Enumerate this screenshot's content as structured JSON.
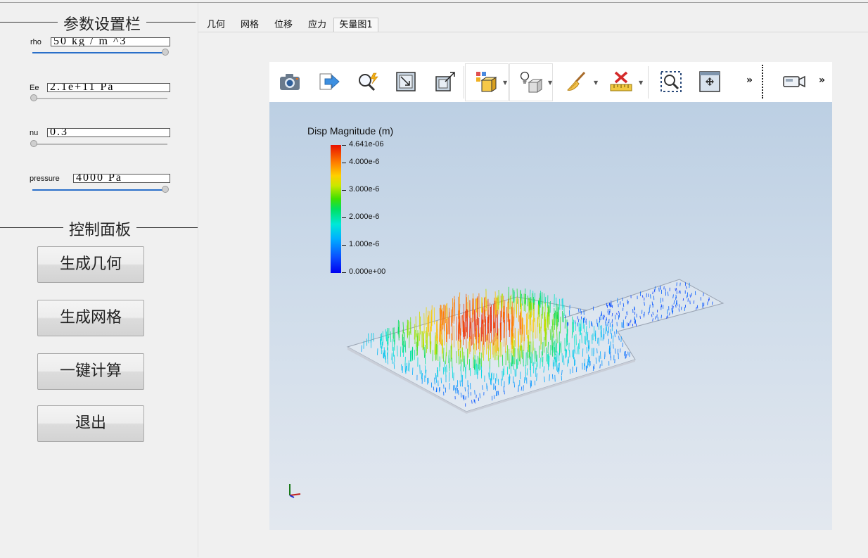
{
  "params": {
    "title": "参数设置栏",
    "items": [
      {
        "label": "rho",
        "value": "50 kg / m ^3",
        "slider": 1.0
      },
      {
        "label": "Ee",
        "value": "2.1e+11 Pa",
        "slider": 0.0
      },
      {
        "label": "nu",
        "value": "0.3",
        "slider": 0.0
      },
      {
        "label": "pressure",
        "value": "4000 Pa",
        "slider": 1.0
      }
    ]
  },
  "control": {
    "title": "控制面板",
    "buttons": [
      "生成几何",
      "生成网格",
      "一键计算",
      "退出"
    ]
  },
  "tabs": [
    {
      "label": "几何",
      "active": false
    },
    {
      "label": "网格",
      "active": false
    },
    {
      "label": "位移",
      "active": false
    },
    {
      "label": "应力",
      "active": false
    },
    {
      "label": "矢量图1",
      "active": true
    }
  ],
  "toolbar": {
    "icons": [
      "camera-icon",
      "export-icon",
      "probe-icon",
      "view-fit-icon",
      "view-expand-icon",
      "representation-icon",
      "lighting-icon",
      "clear-brush-icon",
      "measure-ruler-icon",
      "zoom-box-icon",
      "reset-view-icon",
      "video-camera-icon"
    ]
  },
  "legend": {
    "title": "Disp Magnitude (m)",
    "ticks": [
      "4.641e-06",
      "4.000e-6",
      "3.000e-6",
      "2.000e-6",
      "1.000e-6",
      "0.000e+00"
    ]
  }
}
